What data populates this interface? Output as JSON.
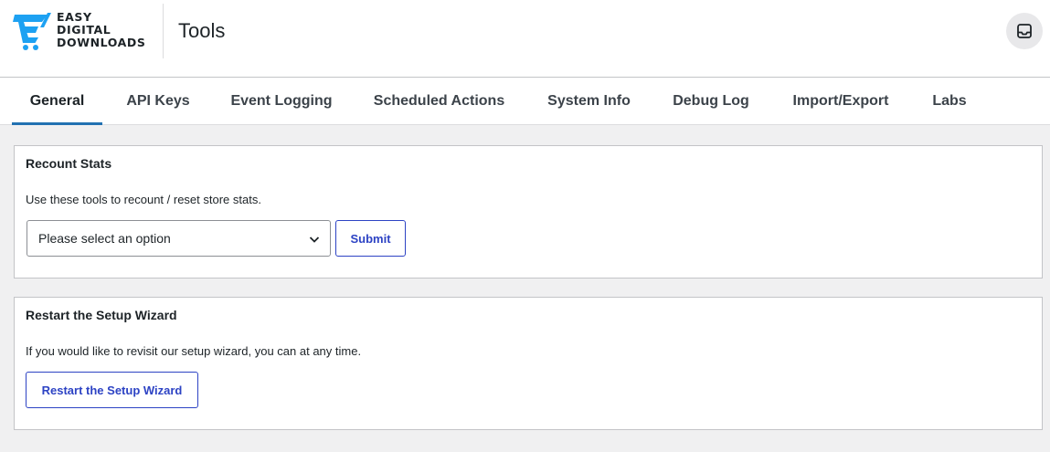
{
  "brand": {
    "logo_line1": "EASY",
    "logo_line2": "DIGITAL",
    "logo_line3": "DOWNLOADS",
    "accent_color": "#1da1f2"
  },
  "header": {
    "title": "Tools",
    "inbox_icon": "inbox-icon"
  },
  "tabs": [
    {
      "label": "General",
      "active": true
    },
    {
      "label": "API Keys"
    },
    {
      "label": "Event Logging"
    },
    {
      "label": "Scheduled Actions"
    },
    {
      "label": "System Info"
    },
    {
      "label": "Debug Log"
    },
    {
      "label": "Import/Export"
    },
    {
      "label": "Labs"
    }
  ],
  "recount": {
    "title": "Recount Stats",
    "description": "Use these tools to recount / reset store stats.",
    "select_value": "Please select an option",
    "submit_label": "Submit"
  },
  "wizard": {
    "title": "Restart the Setup Wizard",
    "description": "If you would like to revisit our setup wizard, you can at any time.",
    "button_label": "Restart the Setup Wizard"
  },
  "colors": {
    "tab_active_underline": "#2271b1",
    "button_primary": "#2d43c4"
  }
}
